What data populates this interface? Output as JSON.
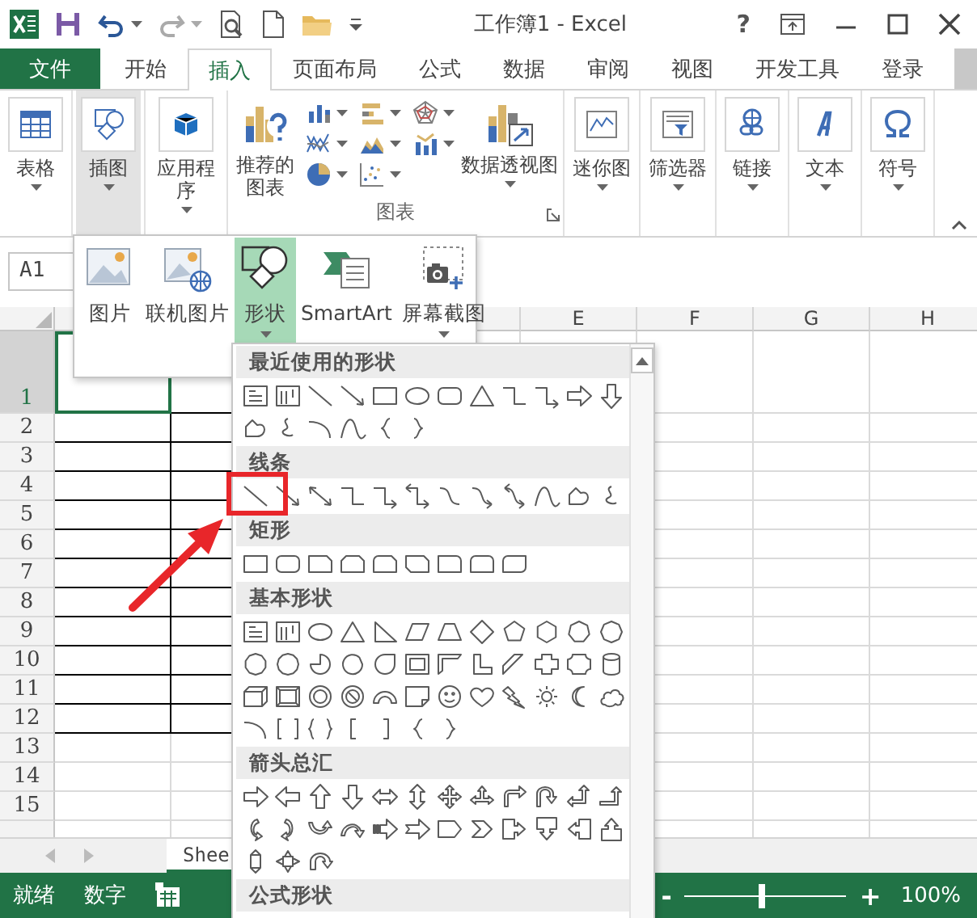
{
  "title_bar": {
    "title": "工作簿1 - Excel",
    "help": "?"
  },
  "ribbon_tabs": [
    {
      "label": "文件",
      "kind": "file",
      "selected": false
    },
    {
      "label": "开始",
      "kind": "tab",
      "selected": false
    },
    {
      "label": "插入",
      "kind": "tab",
      "selected": true
    },
    {
      "label": "页面布局",
      "kind": "tab",
      "selected": false
    },
    {
      "label": "公式",
      "kind": "tab",
      "selected": false
    },
    {
      "label": "数据",
      "kind": "tab",
      "selected": false
    },
    {
      "label": "审阅",
      "kind": "tab",
      "selected": false
    },
    {
      "label": "视图",
      "kind": "tab",
      "selected": false
    },
    {
      "label": "开发工具",
      "kind": "tab",
      "selected": false
    },
    {
      "label": "登录",
      "kind": "tab",
      "selected": false
    }
  ],
  "ribbon": {
    "items": [
      {
        "kind": "large",
        "label": "表格",
        "pressed": false
      },
      {
        "kind": "large",
        "label": "插图",
        "pressed": true
      },
      {
        "kind": "large",
        "label": "应用程序",
        "pressed": false
      },
      {
        "kind": "charts",
        "label": "推荐的图表",
        "pivot": "数据透视图",
        "group": "图表"
      },
      {
        "kind": "large",
        "label": "迷你图",
        "pressed": false
      },
      {
        "kind": "large",
        "label": "筛选器",
        "pressed": false
      },
      {
        "kind": "large",
        "label": "链接",
        "pressed": false
      },
      {
        "kind": "large",
        "label": "文本",
        "pressed": false
      },
      {
        "kind": "large",
        "label": "符号",
        "pressed": false
      }
    ]
  },
  "formula_bar": {
    "name_box": "A1"
  },
  "sheet": {
    "column_headers": [
      "E",
      "F",
      "G",
      "H"
    ],
    "rows": [
      {
        "label": "1",
        "selected": true,
        "bordered": true
      },
      {
        "label": "2",
        "selected": false,
        "bordered": true
      },
      {
        "label": "3",
        "selected": false,
        "bordered": true
      },
      {
        "label": "4",
        "selected": false,
        "bordered": true
      },
      {
        "label": "5",
        "selected": false,
        "bordered": true
      },
      {
        "label": "6",
        "selected": false,
        "bordered": true
      },
      {
        "label": "7",
        "selected": false,
        "bordered": true
      },
      {
        "label": "8",
        "selected": false,
        "bordered": true
      },
      {
        "label": "9",
        "selected": false,
        "bordered": true
      },
      {
        "label": "10",
        "selected": false,
        "bordered": true
      },
      {
        "label": "11",
        "selected": false,
        "bordered": true
      },
      {
        "label": "12",
        "selected": false,
        "bordered": true
      },
      {
        "label": "13",
        "selected": false,
        "bordered": false
      },
      {
        "label": "14",
        "selected": false,
        "bordered": false
      },
      {
        "label": "15",
        "selected": false,
        "bordered": false
      }
    ]
  },
  "sheet_tabs": [
    {
      "label": "Shee",
      "selected": true
    }
  ],
  "status_bar": {
    "ready": "就绪",
    "mode": "数字",
    "zoom_out": "-",
    "zoom_in": "+",
    "zoom": {
      "level": 0.48
    },
    "zoom_text": "100%"
  },
  "illustrations_menu": [
    {
      "label": "图片",
      "selected": false
    },
    {
      "label": "联机图片",
      "selected": false
    },
    {
      "label": "形状",
      "selected": true
    },
    {
      "label": "SmartArt",
      "selected": false
    },
    {
      "label": "屏幕截图",
      "selected": false
    }
  ],
  "shapes_gallery": {
    "sections": [
      {
        "title": "最近使用的形状"
      },
      {
        "title": "线条"
      },
      {
        "title": "矩形"
      },
      {
        "title": "基本形状"
      },
      {
        "title": "箭头总汇"
      },
      {
        "title": "公式形状"
      }
    ]
  }
}
